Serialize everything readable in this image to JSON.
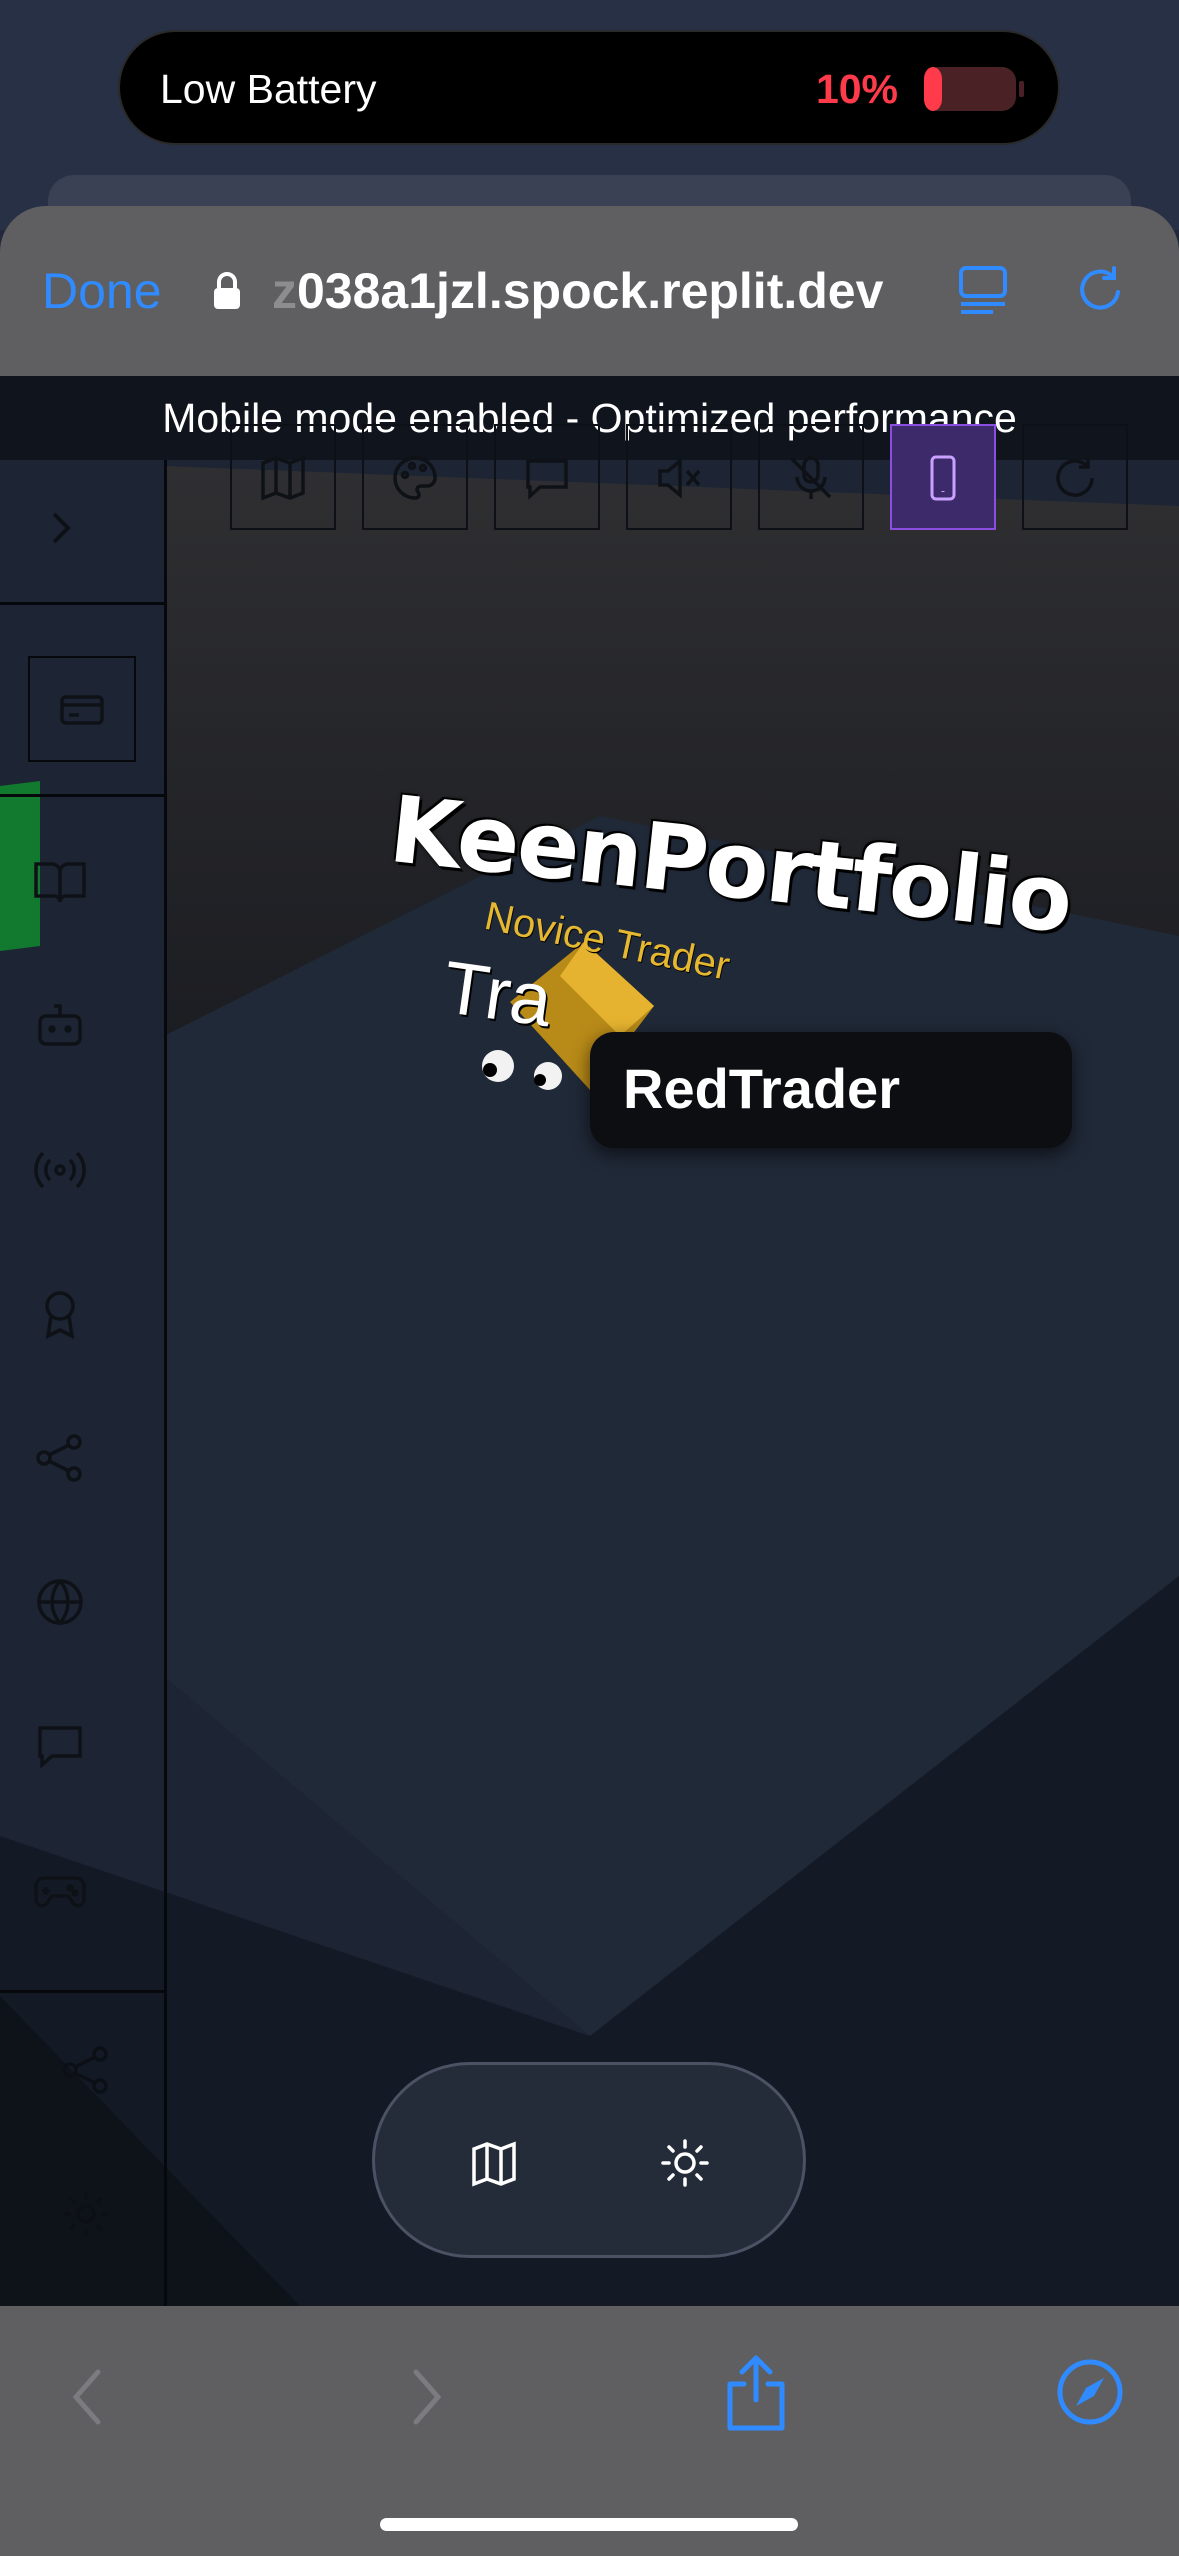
{
  "status": {
    "battery_label": "Low Battery",
    "battery_percent": "10%",
    "battery_level": 0.1,
    "battery_color": "#ff3b4b"
  },
  "browser": {
    "done_label": "Done",
    "url_faded_prefix": "z",
    "url": "038a1jzl.spock.replit.dev",
    "accent": "#2f8bff",
    "icons": [
      "lock-icon",
      "reader-icon",
      "reload-icon"
    ]
  },
  "app": {
    "banner": "Mobile mode enabled - Optimized performance",
    "toolbar": [
      "map-icon",
      "palette-icon",
      "chat-icon",
      "mute-icon",
      "mic-off-icon",
      "mobile-icon",
      "refresh-icon"
    ],
    "toolbar_active": "mobile-icon",
    "sidebar": [
      "chevron-right-icon",
      "card-icon",
      "book-icon",
      "bot-icon",
      "broadcast-icon",
      "award-icon",
      "share-icon",
      "globe-icon",
      "message-icon",
      "gamepad-icon",
      "share-icon",
      "gear-icon"
    ],
    "scene_title": "KeenPortfolio",
    "scene_rank": "Novice Trader",
    "scene_partial": "Tra",
    "player_name": "RedTrader",
    "bottom_controls": [
      "map-icon",
      "sun-icon"
    ]
  },
  "safari_nav": [
    "back-icon",
    "forward-icon",
    "share-icon",
    "compass-icon"
  ]
}
